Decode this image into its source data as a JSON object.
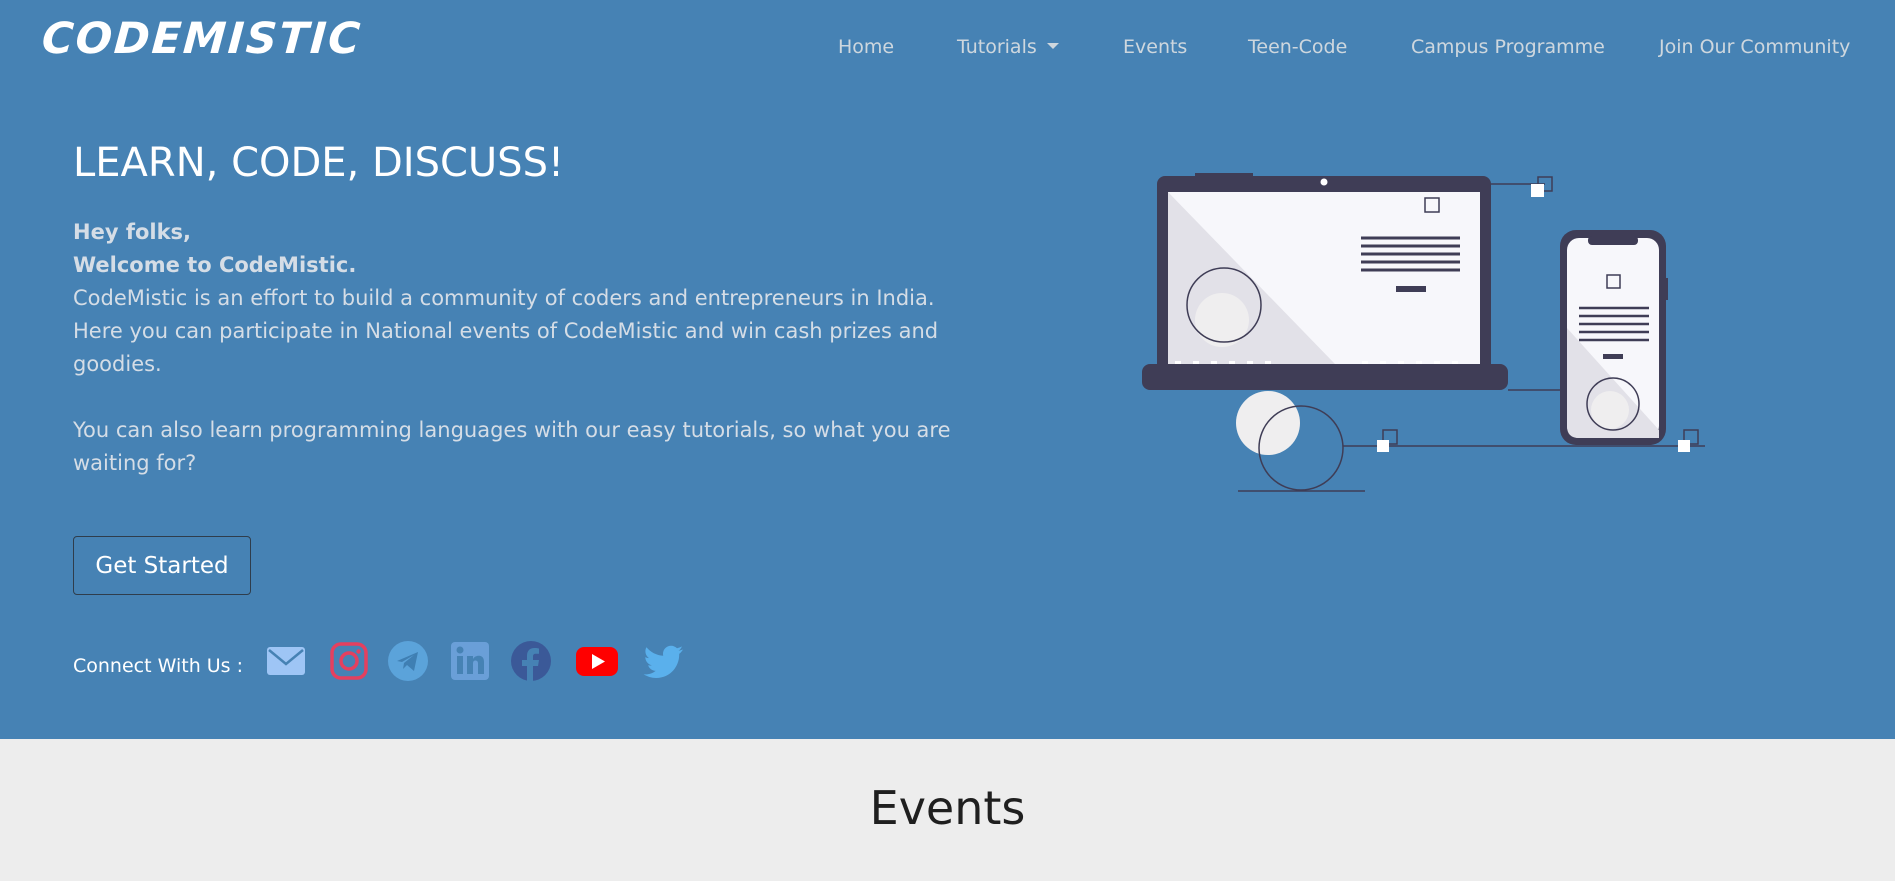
{
  "brand": "CODEMISTIC",
  "nav": {
    "home": "Home",
    "tutorials": "Tutorials",
    "events": "Events",
    "teen_code": "Teen-Code",
    "campus": "Campus Programme",
    "community": "Join Our Community"
  },
  "hero": {
    "headline": "LEARN, CODE, DISCUSS!",
    "greeting": "Hey folks,",
    "welcome": "Welcome to CodeMistic.",
    "para1": "CodeMistic is an effort to build a community of coders and entrepreneurs in India. Here you can participate in National events of CodeMistic and win cash prizes and goodies.",
    "para2": "You can also learn programming languages with our easy tutorials, so what you are waiting for?",
    "cta": "Get Started",
    "connect_label": "Connect With Us :"
  },
  "social_icons": [
    "email-icon",
    "instagram-icon",
    "telegram-icon",
    "linkedin-icon",
    "facebook-icon",
    "youtube-icon",
    "twitter-icon"
  ],
  "events_section": {
    "title": "Events"
  },
  "colors": {
    "hero_bg": "#4682b4",
    "events_bg": "#ededed",
    "illustration_dark": "#3f3d56",
    "youtube_red": "#ff0000",
    "twitter_blue": "#55acee",
    "facebook_blue": "#3b5998"
  }
}
